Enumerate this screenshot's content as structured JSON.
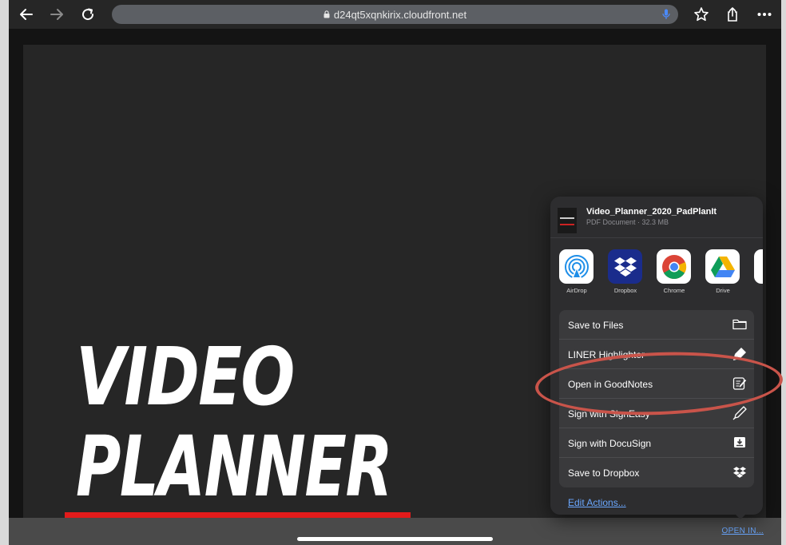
{
  "browser": {
    "url": "d24qt5xqnkirix.cloudfront.net",
    "back_icon": "arrow-left-icon",
    "forward_icon": "arrow-right-icon",
    "reload_icon": "reload-icon",
    "lock_icon": "lock-icon",
    "mic_icon": "microphone-icon",
    "bookmark_icon": "star-icon",
    "share_icon": "share-icon",
    "more_icon": "ellipsis-icon"
  },
  "document": {
    "title_line1": "VIDEO",
    "title_line2": "PLANNER",
    "accent_color": "#e21b1b"
  },
  "share_sheet": {
    "file_name": "Video_Planner_2020_PadPlanIt",
    "file_meta": "PDF Document · 32.3 MB",
    "apps": [
      {
        "label": "AirDrop",
        "icon": "airdrop-icon"
      },
      {
        "label": "Dropbox",
        "icon": "dropbox-icon"
      },
      {
        "label": "Chrome",
        "icon": "chrome-icon"
      },
      {
        "label": "Drive",
        "icon": "google-drive-icon"
      },
      {
        "label": "",
        "icon": "partial-app-icon"
      }
    ],
    "actions": [
      {
        "label": "Save to Files",
        "icon": "folder-icon"
      },
      {
        "label": "LINER Highlighter",
        "icon": "highlighter-icon"
      },
      {
        "label": "Open in GoodNotes",
        "icon": "goodnotes-icon"
      },
      {
        "label": "Sign with SignEasy",
        "icon": "pen-nib-icon"
      },
      {
        "label": "Sign with DocuSign",
        "icon": "docusign-icon"
      },
      {
        "label": "Save to Dropbox",
        "icon": "dropbox-icon"
      }
    ],
    "edit_actions_label": "Edit Actions..."
  },
  "bottom_bar": {
    "open_in_label": "OPEN IN..."
  },
  "annotation": {
    "highlighted_action": "Open in GoodNotes",
    "color": "#c9544a"
  }
}
